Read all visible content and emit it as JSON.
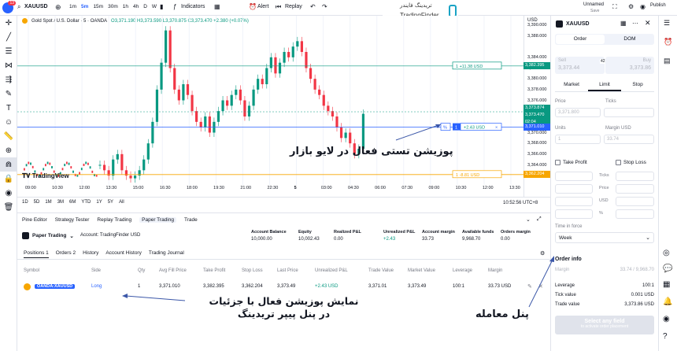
{
  "topbar": {
    "symbol": "XAUUSD",
    "badge": "13",
    "intervals": [
      "1m",
      "5m",
      "15m",
      "30m",
      "1h",
      "4h",
      "D",
      "W"
    ],
    "indicators": "Indicators",
    "alert": "Alert",
    "replay": "Replay",
    "layout_name": "Unnamed",
    "layout_status": "Save",
    "publish": "Publish"
  },
  "logo": {
    "fa": "تریدینگ فایندر",
    "en": "TradingFinder"
  },
  "legend": {
    "title": "Gold Spot / U.S. Dollar · 5 · OANDA",
    "values": "O3,371.190  H3,373.590  L3,370.875  C3,373.470  +2.380 (+0.07%)"
  },
  "chart_data": {
    "type": "line",
    "x_ticks": [
      "09:00",
      "10:30",
      "12:00",
      "13:30",
      "15:00",
      "16:30",
      "18:00",
      "19:30",
      "21:00",
      "22:30",
      "5",
      "03:00",
      "04:30",
      "06:00",
      "07:30",
      "09:00",
      "10:30",
      "12:00",
      "13:30"
    ],
    "y_ticks": [
      "3,390.000",
      "3,388.000",
      "3,384.000",
      "3,382.000",
      "3,380.000",
      "3,378.000",
      "3,376.000",
      "3,374.000",
      "3,370.000",
      "3,368.000",
      "3,366.000",
      "3,364.000",
      "3,362.000"
    ],
    "y_range": [
      3361,
      3391
    ],
    "close": [
      3364,
      3363,
      3362,
      3365,
      3366,
      3363,
      3362,
      3361.5,
      3362,
      3363,
      3365,
      3368,
      3372,
      3378,
      3383,
      3389,
      3382,
      3378,
      3376,
      3379,
      3377,
      3374,
      3372,
      3371,
      3373,
      3370,
      3372,
      3374,
      3376,
      3375,
      3377,
      3378,
      3376,
      3373,
      3375,
      3378,
      3380,
      3379,
      3382,
      3384,
      3381,
      3383,
      3385,
      3384,
      3386,
      3387,
      3385,
      3382,
      3380,
      3378,
      3377,
      3375,
      3374,
      3373,
      3371,
      3369,
      3370,
      3368,
      3366,
      3367,
      3373.5
    ],
    "tp_price": 3382.39,
    "entry_price": 3371.01,
    "sl_price": 3362.2,
    "current_price": 3373.874,
    "tp_label": "+11.38 USD",
    "entry_label": "+2.43 USD",
    "sl_label": "-8.81 USD",
    "entry_qty": "1"
  },
  "price_labels": {
    "tp": "3,382.395",
    "current": "3,373.874",
    "current2": "3,373.470",
    "countdown": "02:04",
    "entry": "3,371.010",
    "sl": "3,362.204"
  },
  "rangebar": {
    "ranges": [
      "1D",
      "5D",
      "1M",
      "3M",
      "6M",
      "YTD",
      "1Y",
      "5Y",
      "All"
    ],
    "clock": "10:52:56 UTC+8"
  },
  "tabs": [
    "Pine Editor",
    "Strategy Tester",
    "Replay Trading",
    "Paper Trading",
    "Trade"
  ],
  "panel": {
    "broker": "Paper Trading",
    "account": "Account: TradingFinder USD",
    "stats": [
      {
        "k": "Account Balance",
        "v": "10,000.00"
      },
      {
        "k": "Equity",
        "v": "10,002.43"
      },
      {
        "k": "Realized P&L",
        "v": "0.00"
      },
      {
        "k": "Unrealized P&L",
        "v": "+2.43"
      },
      {
        "k": "Account margin",
        "v": "33.73"
      },
      {
        "k": "Available funds",
        "v": "9,968.70"
      },
      {
        "k": "Orders margin",
        "v": "0.00"
      }
    ]
  },
  "postabs": [
    "Positions 1",
    "Orders 2",
    "History",
    "Account History",
    "Trading Journal"
  ],
  "positions": {
    "headers": [
      "Symbol",
      "Side",
      "Qty",
      "Avg Fill Price",
      "Take Profit",
      "Stop Loss",
      "Last Price",
      "Unrealized P&L",
      "Trade Value",
      "Market Value",
      "Leverage",
      "Margin"
    ],
    "row": [
      "OANDA:XAUUSD",
      "Long",
      "1",
      "3,371.010",
      "3,382.395",
      "3,362.204",
      "3,373.49",
      "+2.43 USD",
      "3,371.01",
      "3,373.49",
      "100:1",
      "33.73 USD"
    ]
  },
  "annotations": {
    "chart": "پوزیشن تستی فعال در لایو بازار",
    "panel": "نمایش پوزیشن فعال با جزئیات\nدر پنل پیپر تریدینگ",
    "order": "پنل معامله"
  },
  "order": {
    "symbol": "XAUUSD",
    "tab_order": "Order",
    "tab_dom": "DOM",
    "sell": "Sell",
    "sell_price": "3,373.44",
    "spread": "42.0",
    "buy": "Buy",
    "buy_price": "3,373.86",
    "types": [
      "Market",
      "Limit",
      "Stop"
    ],
    "price_label": "Price",
    "ticks_label": "Ticks",
    "price_val": "3,371.800",
    "units_label": "Units",
    "margin_label": "Margin USD",
    "units_val": "1",
    "margin_val": "33.74",
    "tp_label": "Take Profit",
    "sl_label": "Stop Loss",
    "sub_labels": [
      "Ticks",
      "Price",
      "USD",
      "%"
    ],
    "tif_label": "Time in force",
    "tif_val": "Week",
    "info_title": "Order info",
    "info": [
      {
        "k": "Margin",
        "v": "33.74 / 9,968.70"
      },
      {
        "k": "Leverage",
        "v": "100:1"
      },
      {
        "k": "Tick value",
        "v": "0.001 USD"
      },
      {
        "k": "Trade value",
        "v": "3,373.86 USD"
      }
    ],
    "select_btn": "Select any field",
    "select_sub": "to activate order placement"
  },
  "colors": {
    "green": "#089981",
    "red": "#f23645",
    "blue": "#2962ff",
    "orange": "#f7a600"
  }
}
